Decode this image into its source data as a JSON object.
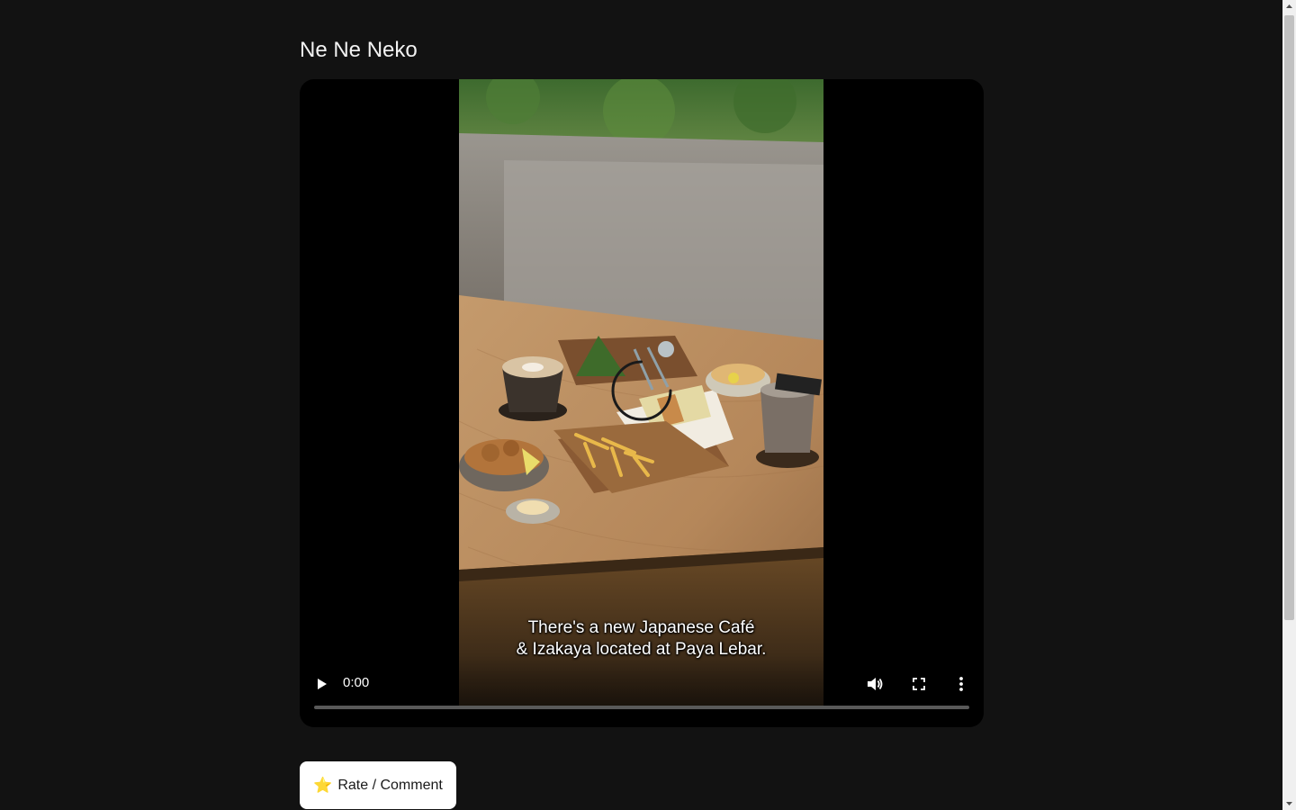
{
  "page": {
    "title": "Ne Ne Neko"
  },
  "video": {
    "caption_line1": "There's a new Japanese Café",
    "caption_line2": "& Izakaya located at Paya Lebar.",
    "current_time": "0:00",
    "progress": 0,
    "state": "loading",
    "controls": {
      "play_icon": "play-icon",
      "volume_icon": "volume-icon",
      "fullscreen_icon": "fullscreen-icon",
      "more_icon": "more-options-icon"
    }
  },
  "actions": {
    "rate_icon": "star-icon",
    "rate_emoji": "⭐",
    "rate_label": "Rate / Comment"
  },
  "colors": {
    "background": "#121212",
    "player_background": "#000000",
    "button_background": "#ffffff",
    "button_text": "#1a1a1a"
  }
}
